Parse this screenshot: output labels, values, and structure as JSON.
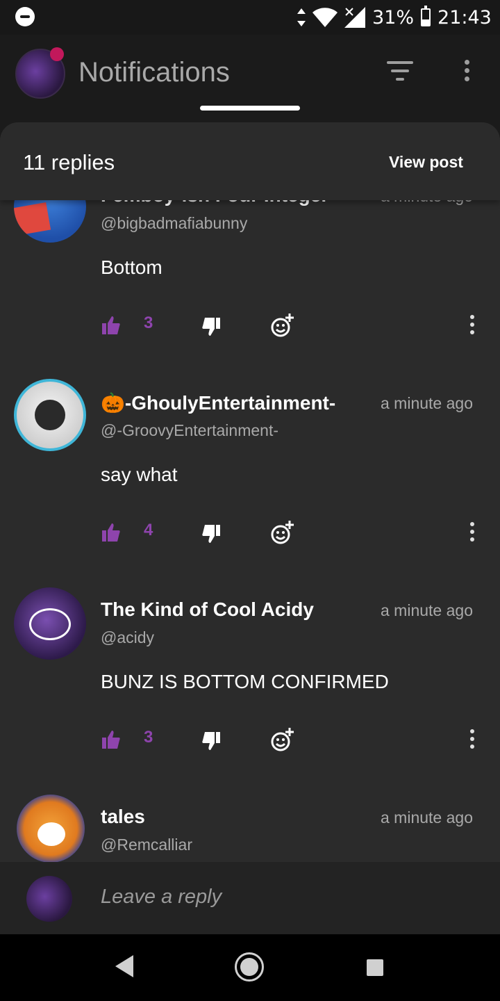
{
  "status_bar": {
    "battery": "31%",
    "time": "21:43"
  },
  "app_bar": {
    "title": "Notifications"
  },
  "sheet": {
    "replies_count": "11 replies",
    "view_post": "View post"
  },
  "comments": [
    {
      "name": "Femboy-ish Four Integer",
      "time": "a minute ago",
      "handle": "@bigbadmafiabunny",
      "body": "Bottom",
      "likes": "3"
    },
    {
      "name": "🎃-GhoulyEntertainment-",
      "time": "a minute ago",
      "handle": "@-GroovyEntertainment-",
      "body": "say what",
      "likes": "4"
    },
    {
      "name": "The Kind of Cool Acidy",
      "time": "a minute ago",
      "handle": "@acidy",
      "body": "BUNZ IS BOTTOM CONFIRMED",
      "likes": "3"
    },
    {
      "name": "tales",
      "time": "a minute ago",
      "handle": "@Remcalliar",
      "body": "",
      "likes": ""
    }
  ],
  "reply_bar": {
    "placeholder": "Leave a reply"
  },
  "colors": {
    "accent": "#8e44ad",
    "sheet_bg": "#2b2b2b",
    "muted": "#a9a9a9"
  },
  "icons": [
    "dnd-icon",
    "wifi-icon",
    "signal-icon",
    "battery-icon",
    "filter-icon",
    "more-vert-icon",
    "thumbs-up-icon",
    "thumbs-down-icon",
    "add-reaction-icon",
    "back-icon",
    "home-icon",
    "recents-icon"
  ]
}
